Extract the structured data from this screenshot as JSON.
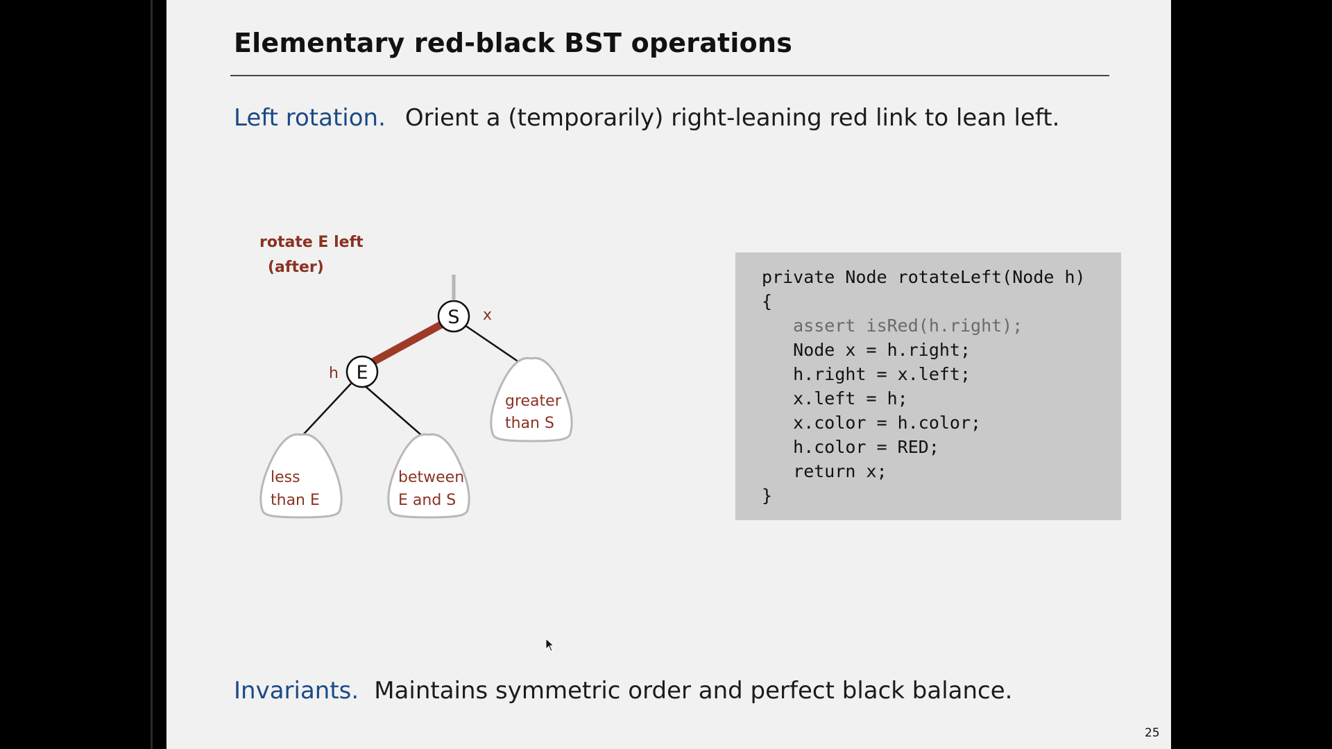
{
  "slide": {
    "title": "Elementary red-black BST operations",
    "bullet1": {
      "lead": "Left rotation.",
      "text": "Orient a (temporarily) right-leaning red link to lean left."
    },
    "bullet2": {
      "lead": "Invariants.",
      "text": "Maintains symmetric order and perfect black balance."
    },
    "page_number": "25"
  },
  "diagram": {
    "caption_line1": "rotate E left",
    "caption_line2": "(after)",
    "nodes": {
      "top": "S",
      "left": "E"
    },
    "pointer_labels": {
      "x": "x",
      "h": "h"
    },
    "subtrees": [
      {
        "line1": "less",
        "line2": "than E"
      },
      {
        "line1": "between",
        "line2": "E and S"
      },
      {
        "line1": "greater",
        "line2": "than S"
      }
    ],
    "colors": {
      "red_link": "#9e3a28",
      "label_red": "#8a3222",
      "lead_blue": "#1a4a86",
      "code_bg": "#c9c9c9"
    }
  },
  "code": [
    {
      "text": "private Node rotateLeft(Node h)",
      "muted": false
    },
    {
      "text": "{",
      "muted": false
    },
    {
      "text": "   assert isRed(h.right);",
      "muted": true
    },
    {
      "text": "   Node x = h.right;",
      "muted": false
    },
    {
      "text": "   h.right = x.left;",
      "muted": false
    },
    {
      "text": "   x.left = h;",
      "muted": false
    },
    {
      "text": "   x.color = h.color;",
      "muted": false
    },
    {
      "text": "   h.color = RED;",
      "muted": false
    },
    {
      "text": "   return x;",
      "muted": false
    },
    {
      "text": "}",
      "muted": false
    }
  ]
}
